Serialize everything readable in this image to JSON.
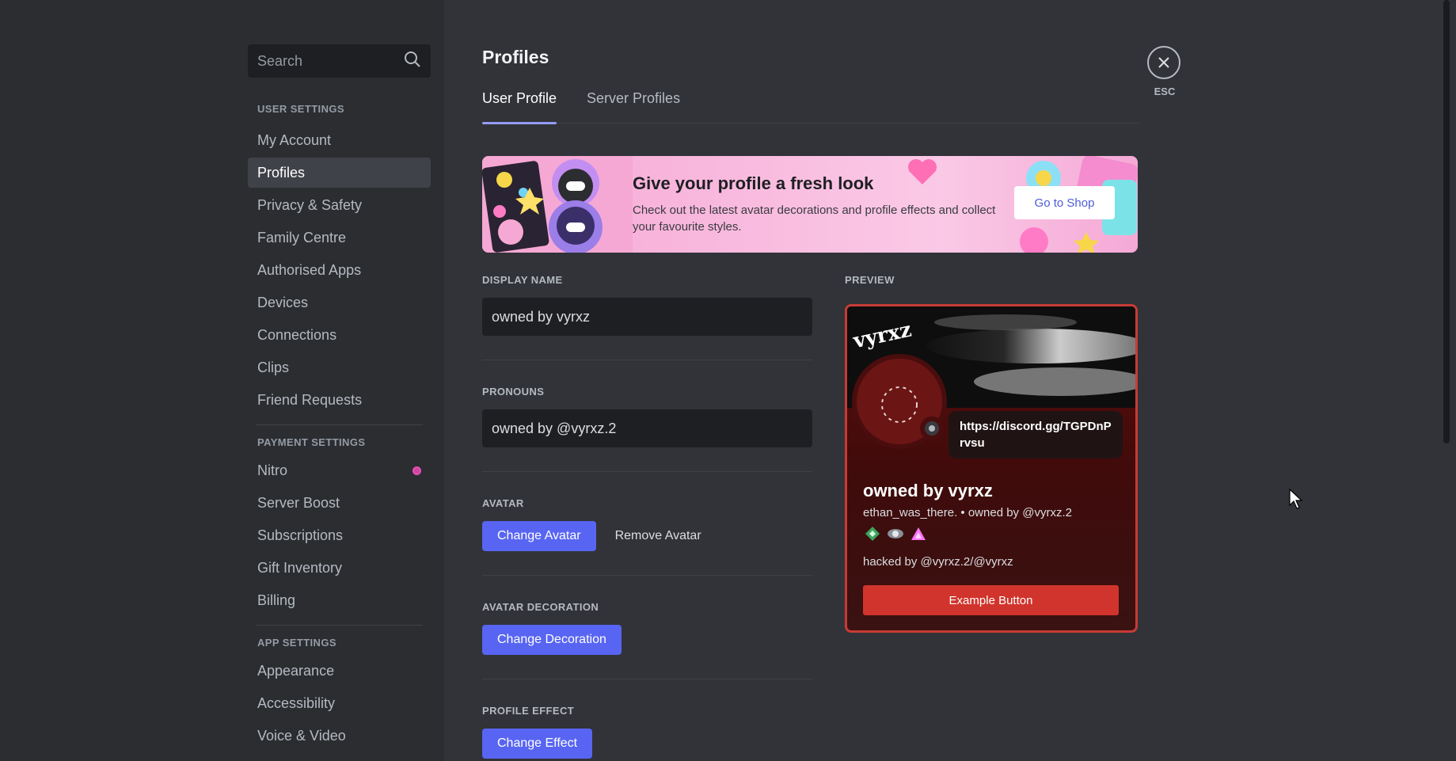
{
  "search": {
    "placeholder": "Search"
  },
  "sidebar": {
    "sections": [
      {
        "header": "USER SETTINGS",
        "items": [
          "My Account",
          "Profiles",
          "Privacy & Safety",
          "Family Centre",
          "Authorised Apps",
          "Devices",
          "Connections",
          "Clips",
          "Friend Requests"
        ]
      },
      {
        "header": "PAYMENT SETTINGS",
        "items": [
          "Nitro",
          "Server Boost",
          "Subscriptions",
          "Gift Inventory",
          "Billing"
        ]
      },
      {
        "header": "APP SETTINGS",
        "items": [
          "Appearance",
          "Accessibility",
          "Voice & Video"
        ]
      }
    ],
    "selected": "Profiles"
  },
  "main": {
    "title": "Profiles",
    "tabs": [
      "User Profile",
      "Server Profiles"
    ],
    "active_tab": "User Profile"
  },
  "banner": {
    "title": "Give your profile a fresh look",
    "description": "Check out the latest avatar decorations and profile effects and collect your favourite styles.",
    "button": "Go to Shop"
  },
  "form": {
    "display_name": {
      "label": "DISPLAY NAME",
      "value": "owned by vyrxz"
    },
    "pronouns": {
      "label": "PRONOUNS",
      "value": "owned by @vyrxz.2"
    },
    "avatar": {
      "label": "AVATAR",
      "change": "Change Avatar",
      "remove": "Remove Avatar"
    },
    "decoration": {
      "label": "AVATAR DECORATION",
      "change": "Change Decoration"
    },
    "effect": {
      "label": "PROFILE EFFECT",
      "change": "Change Effect"
    }
  },
  "preview": {
    "label": "PREVIEW",
    "custom_status": "https://discord.gg/TGPDnPrvsu",
    "display_name": "owned by vyrxz",
    "subline": "ethan_was_there. • owned by @vyrxz.2",
    "bio": "hacked by @vyrxz.2/@vyrxz",
    "example_button": "Example Button",
    "banner_text": "vyrxz",
    "accent_color": "#c83b35"
  },
  "close": {
    "label": "ESC"
  },
  "colors": {
    "brand": "#5865f2",
    "background": "#313338",
    "sidebar": "#2b2d31"
  }
}
